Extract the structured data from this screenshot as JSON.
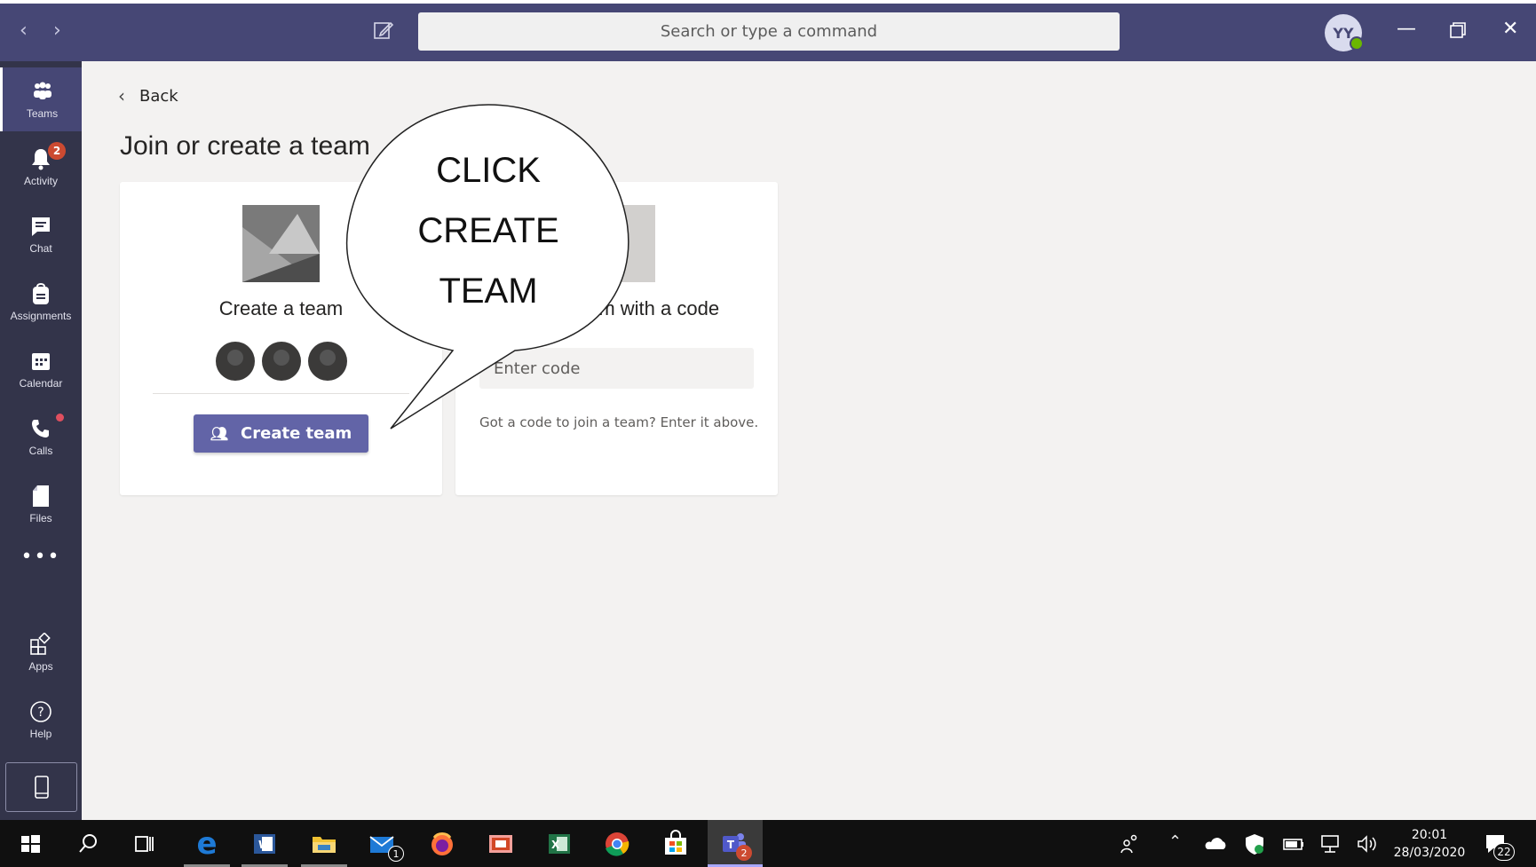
{
  "titlebar": {
    "search_placeholder": "Search or type a command",
    "avatar_initials": "YY"
  },
  "rail": {
    "items": [
      {
        "label": "Teams"
      },
      {
        "label": "Activity",
        "badge": "2"
      },
      {
        "label": "Chat"
      },
      {
        "label": "Assignments"
      },
      {
        "label": "Calendar"
      },
      {
        "label": "Calls"
      },
      {
        "label": "Files"
      },
      {
        "label": "Apps"
      },
      {
        "label": "Help"
      }
    ]
  },
  "main": {
    "back_label": "Back",
    "title": "Join or create a team",
    "create_card": {
      "title": "Create a team",
      "button_label": "Create team"
    },
    "join_card": {
      "title": "Join a team with a code",
      "input_placeholder": "Enter code",
      "hint": "Got a code to join a team? Enter it above."
    }
  },
  "callout": {
    "lines": [
      "CLICK",
      "CREATE",
      "TEAM"
    ]
  },
  "taskbar": {
    "mail_badge": "1",
    "teams_badge": "2",
    "time": "20:01",
    "date": "28/03/2020",
    "notifications_count": "22"
  },
  "colors": {
    "titlebar": "#464775",
    "rail": "#33344a",
    "accent": "#6264a7",
    "background": "#f3f2f1"
  }
}
